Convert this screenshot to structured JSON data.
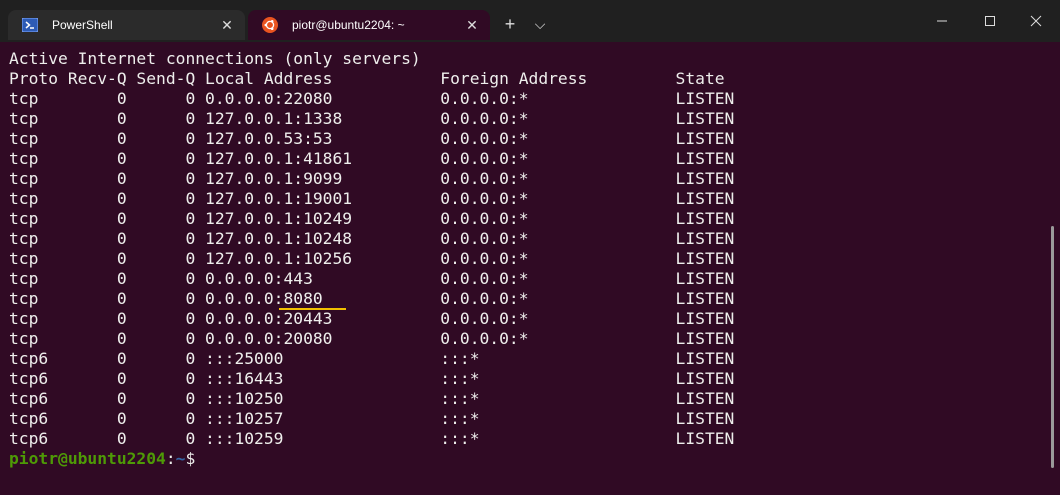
{
  "tabs": [
    {
      "label": "PowerShell",
      "icon": "powershell-icon",
      "active": false
    },
    {
      "label": "piotr@ubuntu2204: ~",
      "icon": "ubuntu-icon",
      "active": true
    }
  ],
  "titlebar": {
    "new_tab_glyph": "+",
    "dropdown_glyph": "⌵"
  },
  "terminal": {
    "header1": "Active Internet connections (only servers)",
    "header2": "Proto Recv-Q Send-Q Local Address           Foreign Address         State",
    "rows": [
      "tcp        0      0 0.0.0.0:22080           0.0.0.0:*               LISTEN",
      "tcp        0      0 127.0.0.1:1338          0.0.0.0:*               LISTEN",
      "tcp        0      0 127.0.0.53:53           0.0.0.0:*               LISTEN",
      "tcp        0      0 127.0.0.1:41861         0.0.0.0:*               LISTEN",
      "tcp        0      0 127.0.0.1:9099          0.0.0.0:*               LISTEN",
      "tcp        0      0 127.0.0.1:19001         0.0.0.0:*               LISTEN",
      "tcp        0      0 127.0.0.1:10249         0.0.0.0:*               LISTEN",
      "tcp        0      0 127.0.0.1:10248         0.0.0.0:*               LISTEN",
      "tcp        0      0 127.0.0.1:10256         0.0.0.0:*               LISTEN",
      "tcp        0      0 0.0.0.0:443             0.0.0.0:*               LISTEN",
      "tcp        0      0 0.0.0.0:8080            0.0.0.0:*               LISTEN",
      "tcp        0      0 0.0.0.0:20443           0.0.0.0:*               LISTEN",
      "tcp        0      0 0.0.0.0:20080           0.0.0.0:*               LISTEN",
      "tcp6       0      0 :::25000                :::*                    LISTEN",
      "tcp6       0      0 :::16443                :::*                    LISTEN",
      "tcp6       0      0 :::10250                :::*                    LISTEN",
      "tcp6       0      0 :::10257                :::*                    LISTEN",
      "tcp6       0      0 :::10259                :::*                    LISTEN"
    ],
    "prompt_user": "piotr@ubuntu2204",
    "prompt_sep": ":",
    "prompt_path": "~",
    "prompt_end": "$ "
  },
  "colors": {
    "terminal_bg": "#300a24",
    "titlebar_bg": "#202020",
    "ubuntu_orange": "#e95420",
    "powershell_blue": "#2d5bb5",
    "prompt_green": "#4e9a06",
    "prompt_blue": "#3465a4",
    "underline_yellow": "#f0c000"
  }
}
